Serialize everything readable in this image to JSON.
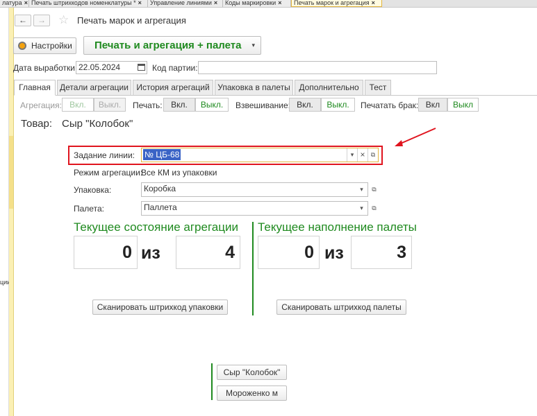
{
  "top_tabs": [
    {
      "label": "латура",
      "active": false
    },
    {
      "label": "Печать штрихкодов номенклатуры *",
      "active": false
    },
    {
      "label": "Управление линиями",
      "active": false
    },
    {
      "label": "Коды маркировки",
      "active": false
    },
    {
      "label": "Печать марок и агрегация",
      "active": true
    }
  ],
  "tab_close": "×",
  "sidebar_label": "ции",
  "header": {
    "back": "←",
    "forward": "→",
    "star": "☆",
    "title": "Печать марок и агрегация"
  },
  "toolbar": {
    "settings_label": "Настройки",
    "print_label": "Печать и агрегация + палета",
    "print_caret": "▾"
  },
  "fields": {
    "date_label": "Дата выработки:",
    "date_value": "22.05.2024",
    "batch_label": "Код партии:",
    "batch_value": ""
  },
  "form_tabs": [
    "Главная",
    "Детали агрегации",
    "История агрегаций",
    "Упаковка в палеты",
    "Дополнительно",
    "Тест"
  ],
  "toggles": {
    "aggregation_label": "Агрегация:",
    "print_label": "Печать:",
    "weighing_label": "Взвешивание:",
    "defect_label": "Печатать брак:",
    "on": "Вкл.",
    "off": "Выкл.",
    "on_short": "Вкл",
    "off_short": "Выкл"
  },
  "product": {
    "label": "Товар:",
    "name": "Сыр \"Колобок\""
  },
  "line_task": {
    "label": "Задание линии:",
    "value": "№ ЦБ-68",
    "dropdown": "▾",
    "clear": "×",
    "open": "⧉"
  },
  "aggregation_mode": {
    "label": "Режим агрегации:",
    "value": "Все КМ из упаковки"
  },
  "packaging": {
    "label": "Упаковка:",
    "value": "Коробка"
  },
  "pallet": {
    "label": "Палета:",
    "value": "Паллета"
  },
  "aggregation_state": {
    "title": "Текущее состояние агрегации",
    "current": "0",
    "separator": "из",
    "total": "4",
    "scan_button": "Сканировать штрихкод упаковки"
  },
  "pallet_state": {
    "title": "Текущее наполнение палеты",
    "current": "0",
    "separator": "из",
    "total": "3",
    "scan_button": "Сканировать штрихкод палеты"
  },
  "products_list": [
    "Сыр \"Колобок\"",
    "Мороженко м"
  ],
  "colors": {
    "accent_green": "#1f8a1f",
    "highlight_red": "#e0141e",
    "selection_blue": "#3a63c6"
  }
}
